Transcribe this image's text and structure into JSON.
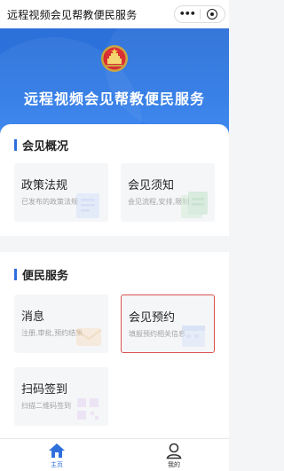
{
  "navbar": {
    "title": "远程视频会见帮教便民服务",
    "more_label": "•••",
    "more_icon": "more-dots-icon",
    "close_icon": "target-close-icon"
  },
  "banner": {
    "emblem_icon": "national-emblem-icon",
    "title": "远程视频会见帮教便民服务"
  },
  "sections": {
    "overview": {
      "title": "会见概况",
      "cards": [
        {
          "title": "政策法规",
          "subtitle": "已发布的政策法规",
          "icon": "policy-doc-icon"
        },
        {
          "title": "会见须知",
          "subtitle": "会见流程,安排,限制",
          "icon": "notice-doc-icon"
        }
      ]
    },
    "services": {
      "title": "便民服务",
      "cards": [
        {
          "title": "消息",
          "subtitle": "注册,审批,预约结果",
          "icon": "message-icon"
        },
        {
          "title": "会见预约",
          "subtitle": "填报预约相关信息",
          "icon": "appointment-icon"
        },
        {
          "title": "扫码签到",
          "subtitle": "扫描二维码签到",
          "icon": "qr-scan-icon"
        }
      ]
    }
  },
  "tabbar": {
    "items": [
      {
        "label": "主页",
        "icon": "home-icon",
        "active": true
      },
      {
        "label": "我的",
        "icon": "user-icon",
        "active": false
      }
    ]
  },
  "colors": {
    "accent": "#2f6fdc",
    "banner": "#2f7ae5",
    "highlight_border": "#d9534f"
  }
}
